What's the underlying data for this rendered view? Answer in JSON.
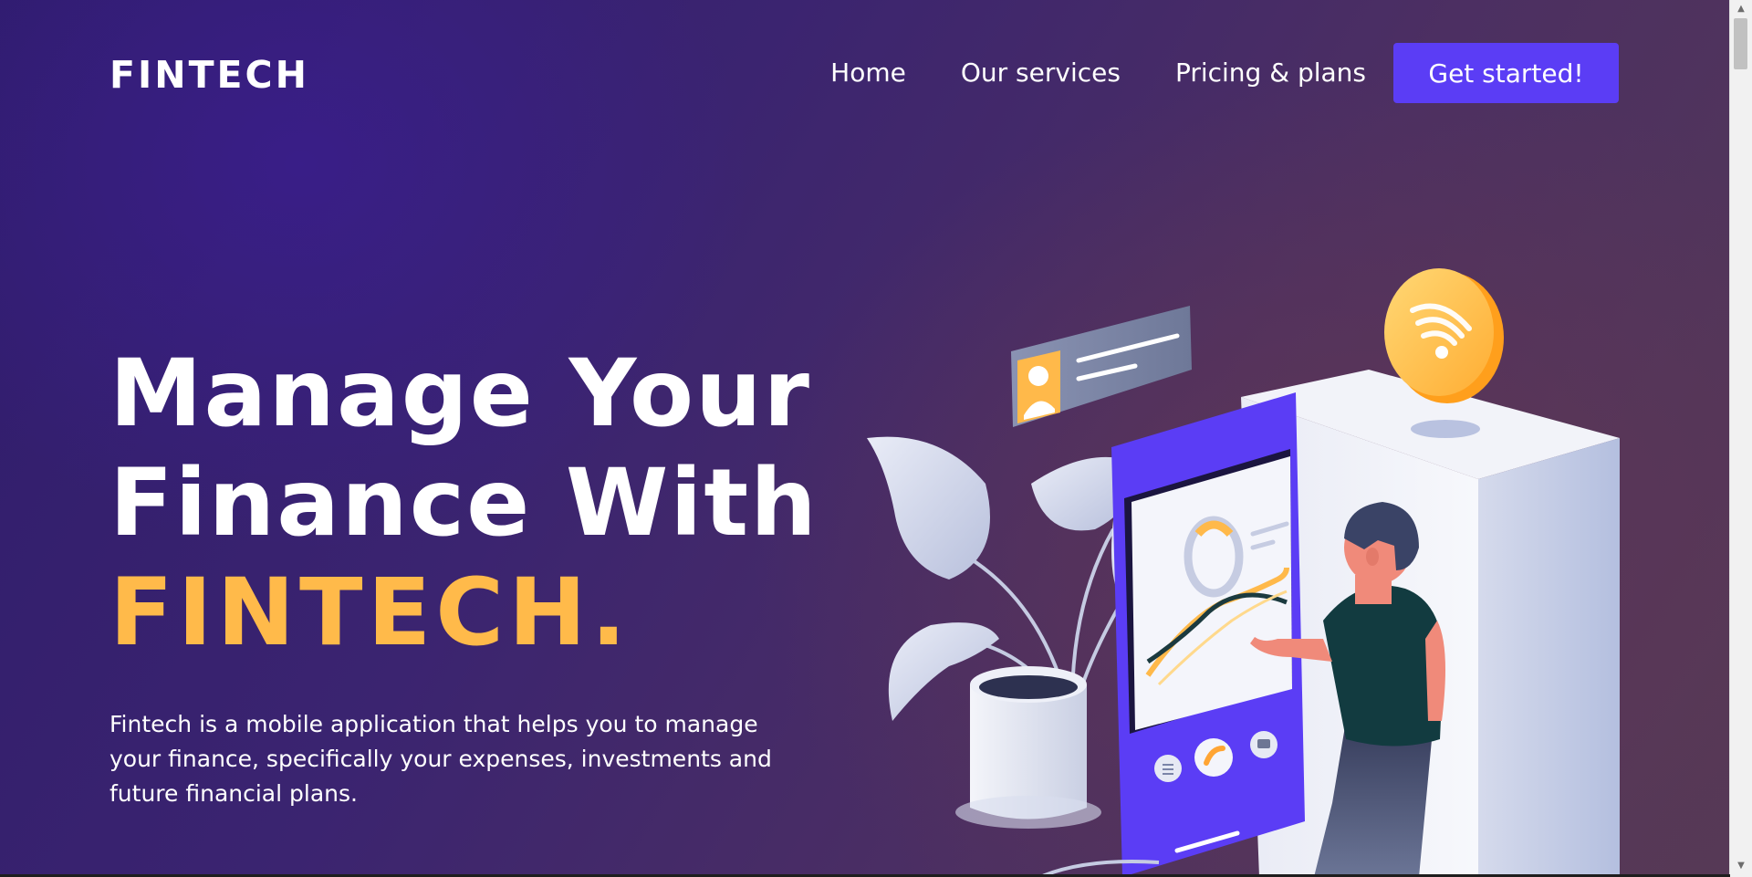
{
  "header": {
    "logo": "FINTECH",
    "nav": {
      "home": "Home",
      "services": "Our services",
      "pricing": "Pricing & plans",
      "cta": "Get started!"
    }
  },
  "hero": {
    "title_line1": "Manage Your",
    "title_line2": "Finance With",
    "title_accent": "FINTECH.",
    "description": "Fintech is a mobile application that helps you to manage your finance, specifically your expenses, investments and future financial plans."
  },
  "colors": {
    "accent": "#ffba4a",
    "button": "#5b3df5"
  },
  "scrollbar": {
    "up_arrow": "▲",
    "down_arrow": "▼"
  }
}
